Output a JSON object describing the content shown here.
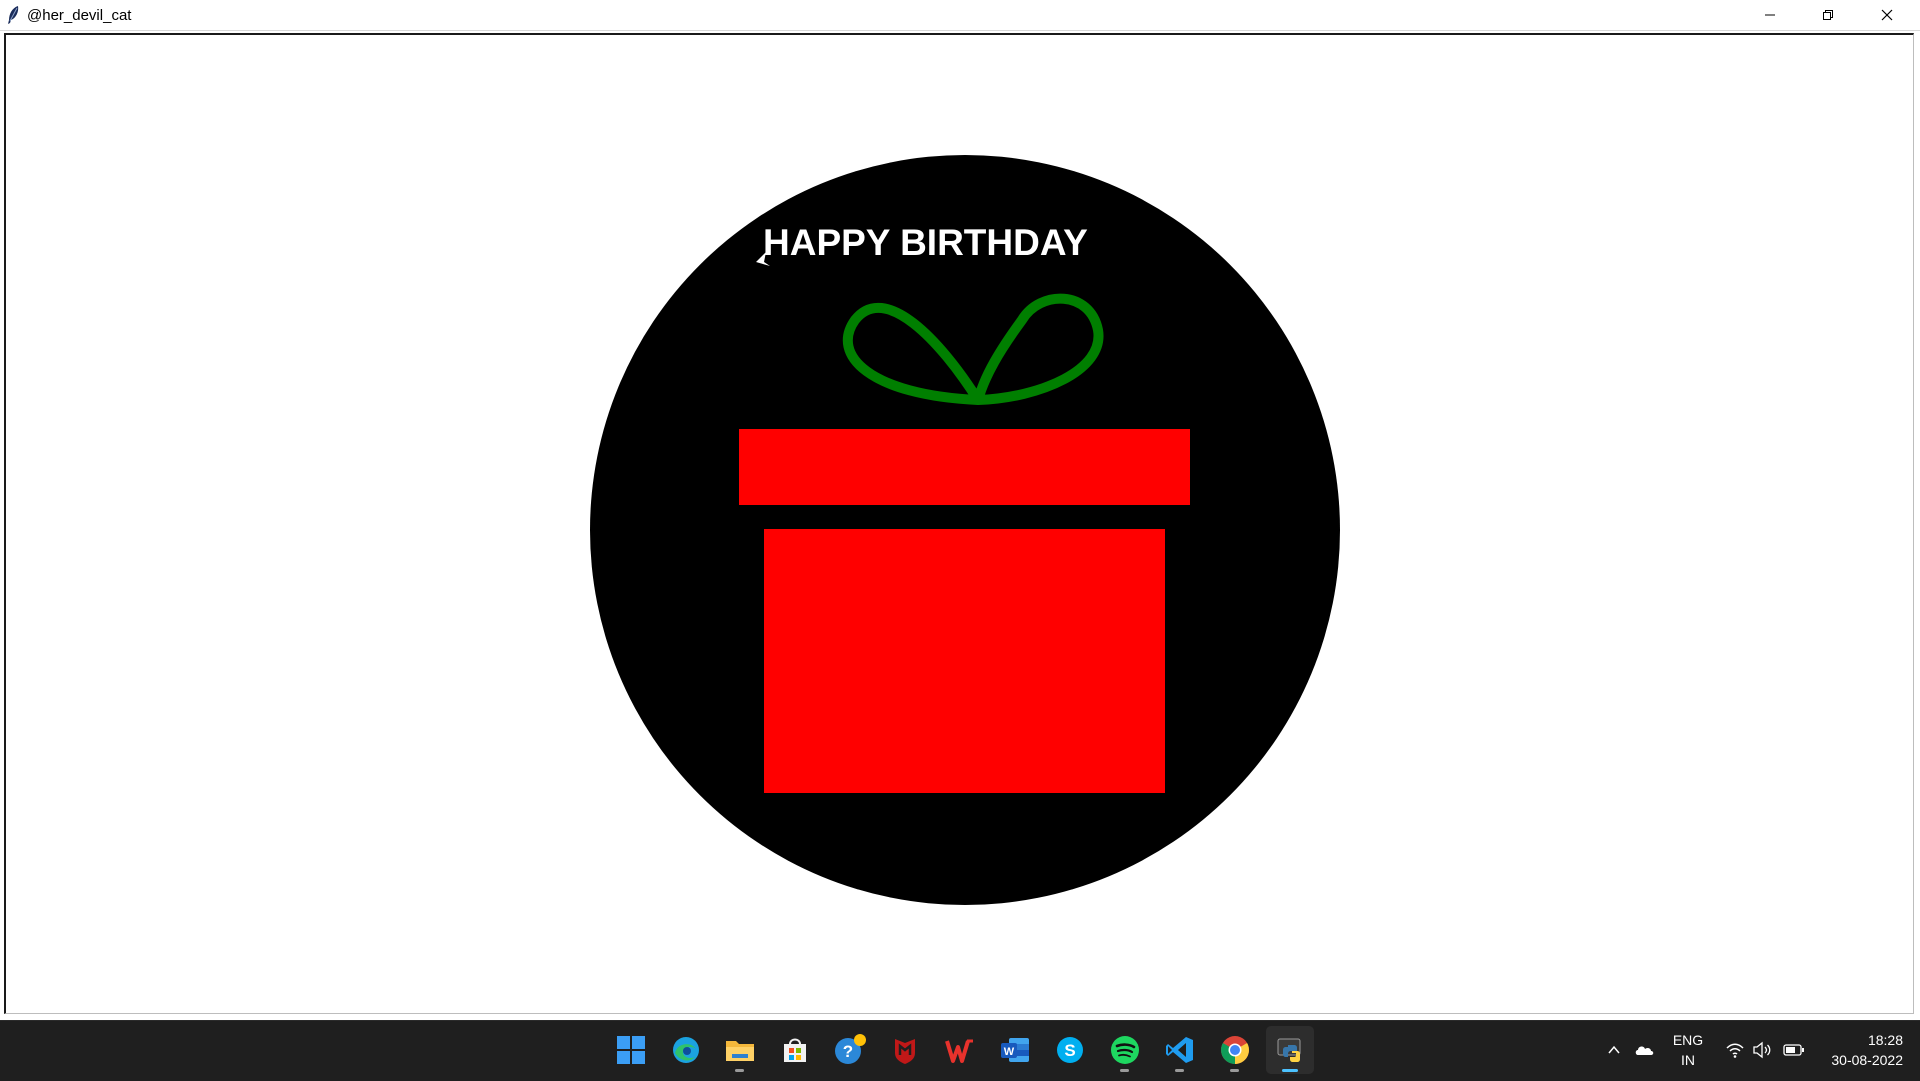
{
  "window": {
    "title": "@her_devil_cat",
    "controls": [
      "minimize",
      "restore",
      "close"
    ]
  },
  "canvas": {
    "greeting": "HAPPY BIRTHDAY",
    "colors": {
      "background": "#ffffff",
      "circle": "#000000",
      "gift": "#ff0000",
      "ribbon": "#008000",
      "text": "#ffffff"
    }
  },
  "taskbar": {
    "apps": [
      {
        "name": "start",
        "icon": "windows-start-icon"
      },
      {
        "name": "edge",
        "icon": "edge-icon"
      },
      {
        "name": "file-explorer",
        "icon": "folder-icon"
      },
      {
        "name": "microsoft-store",
        "icon": "store-icon"
      },
      {
        "name": "get-help",
        "icon": "help-icon"
      },
      {
        "name": "mcafee",
        "icon": "mcafee-icon"
      },
      {
        "name": "wps-office",
        "icon": "wps-icon"
      },
      {
        "name": "word",
        "icon": "word-icon"
      },
      {
        "name": "skype",
        "icon": "skype-icon"
      },
      {
        "name": "spotify",
        "icon": "spotify-icon"
      },
      {
        "name": "vscode",
        "icon": "vscode-icon"
      },
      {
        "name": "chrome",
        "icon": "chrome-icon"
      },
      {
        "name": "python",
        "icon": "python-icon"
      }
    ],
    "tray": {
      "language": "ENG",
      "region": "IN",
      "time": "18:28",
      "date": "30-08-2022"
    }
  }
}
